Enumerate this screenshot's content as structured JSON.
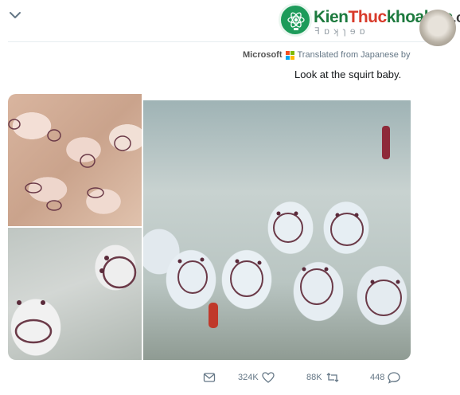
{
  "watermark": {
    "part_a": "Kien",
    "part_b": "Thuc",
    "part_c": "khoahoc",
    "part_d": ".org",
    "icon": "atom-bulb-icon"
  },
  "header": {
    "menu_icon": "chevron-down-icon",
    "mirrored_name": "ꟻ ɒ ʞ ɿ ɘ ɒ"
  },
  "translation": {
    "label": "Translated from Japanese by",
    "provider": "Microsoft",
    "provider_icon": "microsoft-logo-icon",
    "logo_colors": [
      "#f25022",
      "#7fba00",
      "#00a4ef",
      "#ffb900"
    ]
  },
  "tweet": {
    "text": "Look at the squirt baby."
  },
  "media": {
    "images": [
      "sea-squirt-larvae-top-left",
      "sea-squirt-larvae-bottom-left",
      "sea-squirt-larvae-right"
    ]
  },
  "actions": {
    "reply_count": "448",
    "retweet_count": "88K",
    "like_count": "324K",
    "reply_icon": "reply-icon",
    "retweet_icon": "retweet-icon",
    "like_icon": "heart-icon",
    "dm_icon": "mail-icon"
  },
  "colors": {
    "text": "#14171a",
    "secondary": "#657786",
    "divider": "#e6ecf0",
    "watermark_green": "#1d7a3e",
    "watermark_red": "#d83a2a"
  }
}
